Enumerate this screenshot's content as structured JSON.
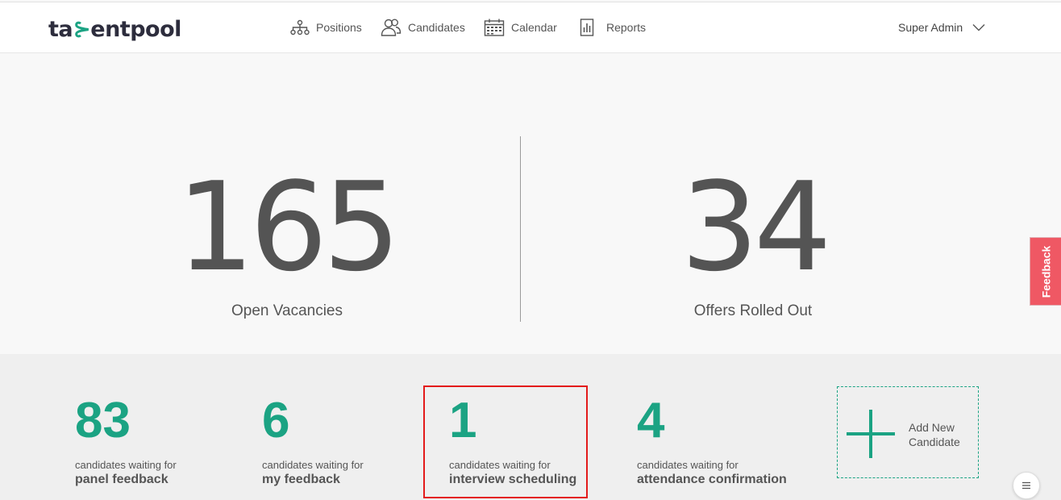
{
  "header": {
    "logo": "talentpool",
    "nav": [
      {
        "label": "Positions",
        "icon": "hierarchy-icon"
      },
      {
        "label": "Candidates",
        "icon": "people-icon"
      },
      {
        "label": "Calendar",
        "icon": "calendar-icon"
      },
      {
        "label": "Reports",
        "icon": "report-icon"
      }
    ],
    "user": "Super Admin"
  },
  "hero": {
    "open_vacancies": {
      "value": "165",
      "label": "Open Vacancies"
    },
    "offers_rolled_out": {
      "value": "34",
      "label": "Offers Rolled Out"
    }
  },
  "stats": [
    {
      "value": "83",
      "line1": "candidates waiting for",
      "line2": "panel feedback"
    },
    {
      "value": "6",
      "line1": "candidates waiting for",
      "line2": "my feedback"
    },
    {
      "value": "1",
      "line1": "candidates waiting for",
      "line2": "interview scheduling"
    },
    {
      "value": "4",
      "line1": "candidates waiting for",
      "line2": "attendance confirmation"
    }
  ],
  "add_new": {
    "label": "Add New Candidate"
  },
  "feedback_tab": "Feedback",
  "colors": {
    "accent": "#1ba383",
    "highlight": "#e31b1b",
    "feedback": "#ef5864"
  }
}
